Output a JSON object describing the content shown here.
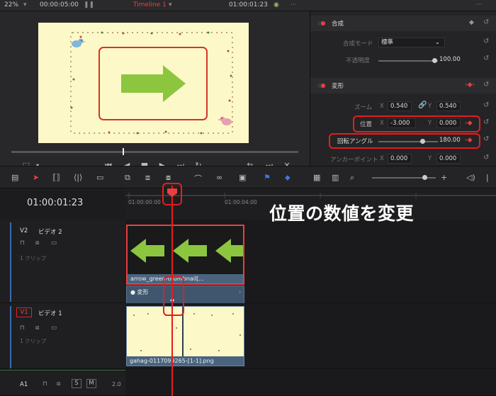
{
  "topbar": {
    "zoom": "22%",
    "source_tc": "00:00:05:00",
    "timeline_name": "Timeline 1",
    "timeline_tc": "01:00:01:23"
  },
  "inspector": {
    "composite": {
      "title": "合成",
      "mode_label": "合成モード",
      "mode_value": "標準",
      "opacity_label": "不透明度",
      "opacity_value": "100.00"
    },
    "transform": {
      "title": "変形",
      "zoom_label": "ズーム",
      "zoom_x": "0.540",
      "zoom_y": "0.540",
      "position_label": "位置",
      "position_x": "-3.000",
      "position_y": "0.000",
      "rotation_label": "回転アングル",
      "rotation_value": "180.00",
      "anchor_label": "アンカーポイント",
      "anchor_x": "0.000",
      "anchor_y": "0.000",
      "axis_x": "X",
      "axis_y": "Y"
    }
  },
  "timeline": {
    "timecode": "01:00:01:23",
    "ruler_marks": [
      "01:00:00:00",
      "01:00:04:00"
    ],
    "v2": {
      "id": "V2",
      "name": "ビデオ 2",
      "clip_count": "1 クリップ",
      "clip_name": "arrow_green-thumbnail[...",
      "fx_label": "変形"
    },
    "v1": {
      "id": "V1",
      "name": "ビデオ 1",
      "clip_count": "1 クリップ",
      "clip_name": "gahag-0117099265-[1-1].png"
    },
    "a1": {
      "id": "A1",
      "s": "S",
      "m": "M",
      "level": "2.0"
    }
  },
  "caption": "位置の数値を変更",
  "colors": {
    "accent_red": "#e31e1e",
    "arrow_green": "#8cc63f",
    "frame_bg": "#fdf8c8"
  }
}
